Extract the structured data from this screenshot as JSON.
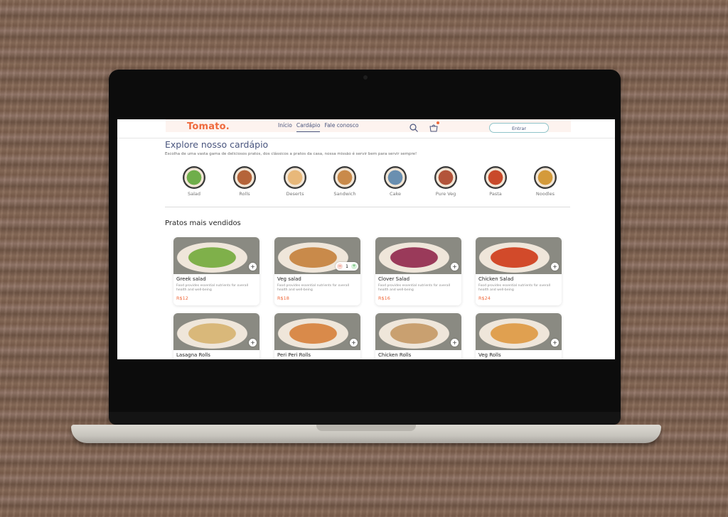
{
  "header": {
    "logo": "Tomato.",
    "menu": [
      "Início",
      "Cardápio",
      "Fale conosco"
    ],
    "active_menu": "Cardápio",
    "signin_label": "Entrar",
    "icons": [
      "search-icon",
      "basket-icon"
    ]
  },
  "explore": {
    "title": "Explore nosso cardápio",
    "description": "Escolha de uma vasta gama de deliciosos pratos, dos clássicos a pratos da casa, nossa missão é servir bem para servir sempre!"
  },
  "categories": [
    {
      "label": "Salad",
      "color": "#6fae4a"
    },
    {
      "label": "Rolls",
      "color": "#b5643a"
    },
    {
      "label": "Deserts",
      "color": "#e8b87a"
    },
    {
      "label": "Sandwich",
      "color": "#c98a4a"
    },
    {
      "label": "Cake",
      "color": "#6a8fb0"
    },
    {
      "label": "Pure Veg",
      "color": "#b3543a"
    },
    {
      "label": "Pasta",
      "color": "#c94a2a"
    },
    {
      "label": "Noodles",
      "color": "#d49a3a"
    }
  ],
  "top_dishes": {
    "title": "Pratos mais vendidos",
    "items": [
      {
        "name": "Greek salad",
        "desc": "Food provides essential nutrients for overall health and well-being",
        "price": "R$12",
        "color": "#7fb04a",
        "count": null
      },
      {
        "name": "Veg salad",
        "desc": "Food provides essential nutrients for overall health and well-being",
        "price": "R$18",
        "color": "#c98a4a",
        "count": "1"
      },
      {
        "name": "Clover Salad",
        "desc": "Food provides essential nutrients for overall health and well-being",
        "price": "R$16",
        "color": "#9a3a5a",
        "count": null
      },
      {
        "name": "Chicken Salad",
        "desc": "Food provides essential nutrients for overall health and well-being",
        "price": "R$24",
        "color": "#d24a2a",
        "count": null
      },
      {
        "name": "Lasagna Rolls",
        "desc": "",
        "price": "",
        "color": "#d9b87a",
        "count": null
      },
      {
        "name": "Peri Peri Rolls",
        "desc": "",
        "price": "",
        "color": "#d98a4a",
        "count": null
      },
      {
        "name": "Chicken Rolls",
        "desc": "",
        "price": "",
        "color": "#c9a070",
        "count": null
      },
      {
        "name": "Veg Rolls",
        "desc": "",
        "price": "",
        "color": "#e0a050",
        "count": null
      }
    ]
  },
  "colors": {
    "brand": "#ef6a3d",
    "nav_text": "#49557e"
  }
}
